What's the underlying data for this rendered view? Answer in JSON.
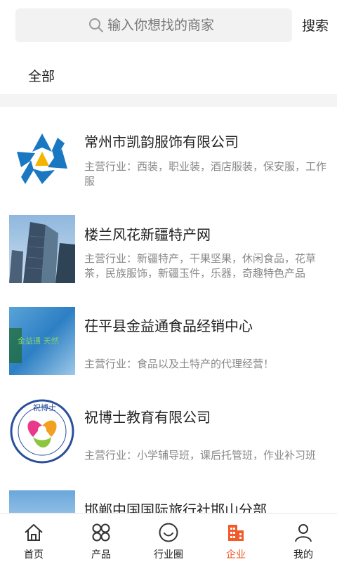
{
  "search": {
    "placeholder": "输入你想找的商家",
    "button_label": "搜索"
  },
  "filter": {
    "tab_all": "全部"
  },
  "companies": [
    {
      "name": "常州市凯韵服饰有限公司",
      "business": "主营行业：西装，职业装，酒店服装，保安服，工作服"
    },
    {
      "name": "楼兰风花新疆特产网",
      "business": "主营行业：新疆特产，干果坚果，休闲食品，花草茶，民族服饰，新疆玉件，乐器，奇趣特色产品"
    },
    {
      "name": "茌平县金益通食品经销中心",
      "business": "主营行业：食品以及土特产的代理经营！"
    },
    {
      "name": "祝博士教育有限公司",
      "business": "主营行业：小学辅导班，课后托管班，作业补习班"
    },
    {
      "name": "邯郸中国国际旅行社邯山分部",
      "business": ""
    }
  ],
  "logo_texts": {
    "thumb3": "金益通 天然",
    "thumb4_top": "祝博士"
  },
  "nav": [
    {
      "label": "首页",
      "icon": "home-icon"
    },
    {
      "label": "产品",
      "icon": "grid-icon"
    },
    {
      "label": "行业圈",
      "icon": "smile-icon"
    },
    {
      "label": "企业",
      "icon": "building-icon"
    },
    {
      "label": "我的",
      "icon": "user-icon"
    }
  ],
  "colors": {
    "accent": "#f25a2a",
    "text": "#222222",
    "muted": "#888888",
    "search_bg": "#f2f2f2"
  }
}
